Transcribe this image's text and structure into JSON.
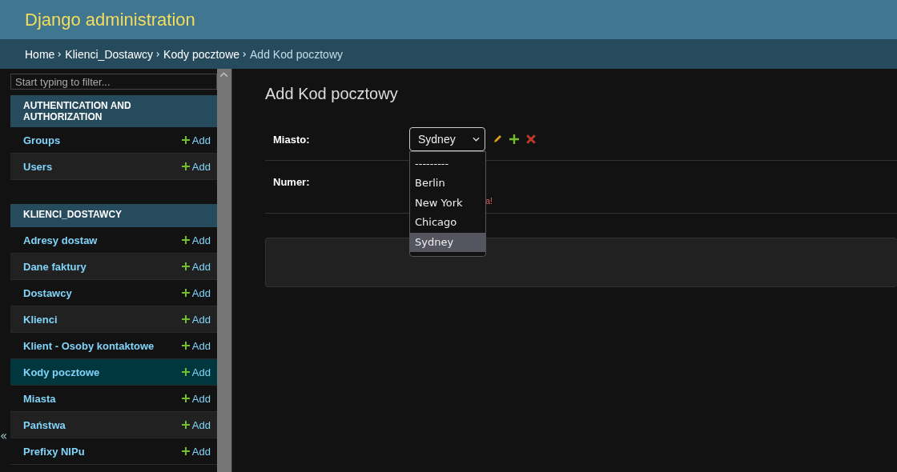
{
  "header": {
    "title": "Django administration"
  },
  "breadcrumbs": [
    "Home",
    "Klienci_Dostawcy",
    "Kody pocztowe",
    "Add Kod pocztowy"
  ],
  "sidebar": {
    "filter": {
      "placeholder": "Start typing to filter..."
    },
    "modules": [
      {
        "caption": "AUTHENTICATION AND AUTHORIZATION",
        "models": [
          {
            "name": "Groups",
            "add": "Add",
            "selected": false
          },
          {
            "name": "Users",
            "add": "Add",
            "selected": false
          }
        ]
      },
      {
        "caption": "KLIENCI_DOSTAWCY",
        "models": [
          {
            "name": "Adresy dostaw",
            "add": "Add",
            "selected": false
          },
          {
            "name": "Dane faktury",
            "add": "Add",
            "selected": false
          },
          {
            "name": "Dostawcy",
            "add": "Add",
            "selected": false
          },
          {
            "name": "Klienci",
            "add": "Add",
            "selected": false
          },
          {
            "name": "Klient - Osoby kontaktowe",
            "add": "Add",
            "selected": false
          },
          {
            "name": "Kody pocztowe",
            "add": "Add",
            "selected": true
          },
          {
            "name": "Miasta",
            "add": "Add",
            "selected": false
          },
          {
            "name": "Państwa",
            "add": "Add",
            "selected": false
          },
          {
            "name": "Prefixy NIPu",
            "add": "Add",
            "selected": false
          }
        ]
      }
    ],
    "collapse": "«"
  },
  "content": {
    "title": "Add Kod pocztowy",
    "fields": [
      {
        "kind": "select",
        "label": "Miasto:",
        "value": "Sydney",
        "expanded": true,
        "options": [
          {
            "label": "---------",
            "selected": false
          },
          {
            "label": "Berlin",
            "selected": false
          },
          {
            "label": "New York",
            "selected": false
          },
          {
            "label": "Chicago",
            "selected": false
          },
          {
            "label": "Sydney",
            "selected": true
          }
        ]
      },
      {
        "kind": "text",
        "label": "Numer:",
        "help": "a!"
      }
    ]
  }
}
